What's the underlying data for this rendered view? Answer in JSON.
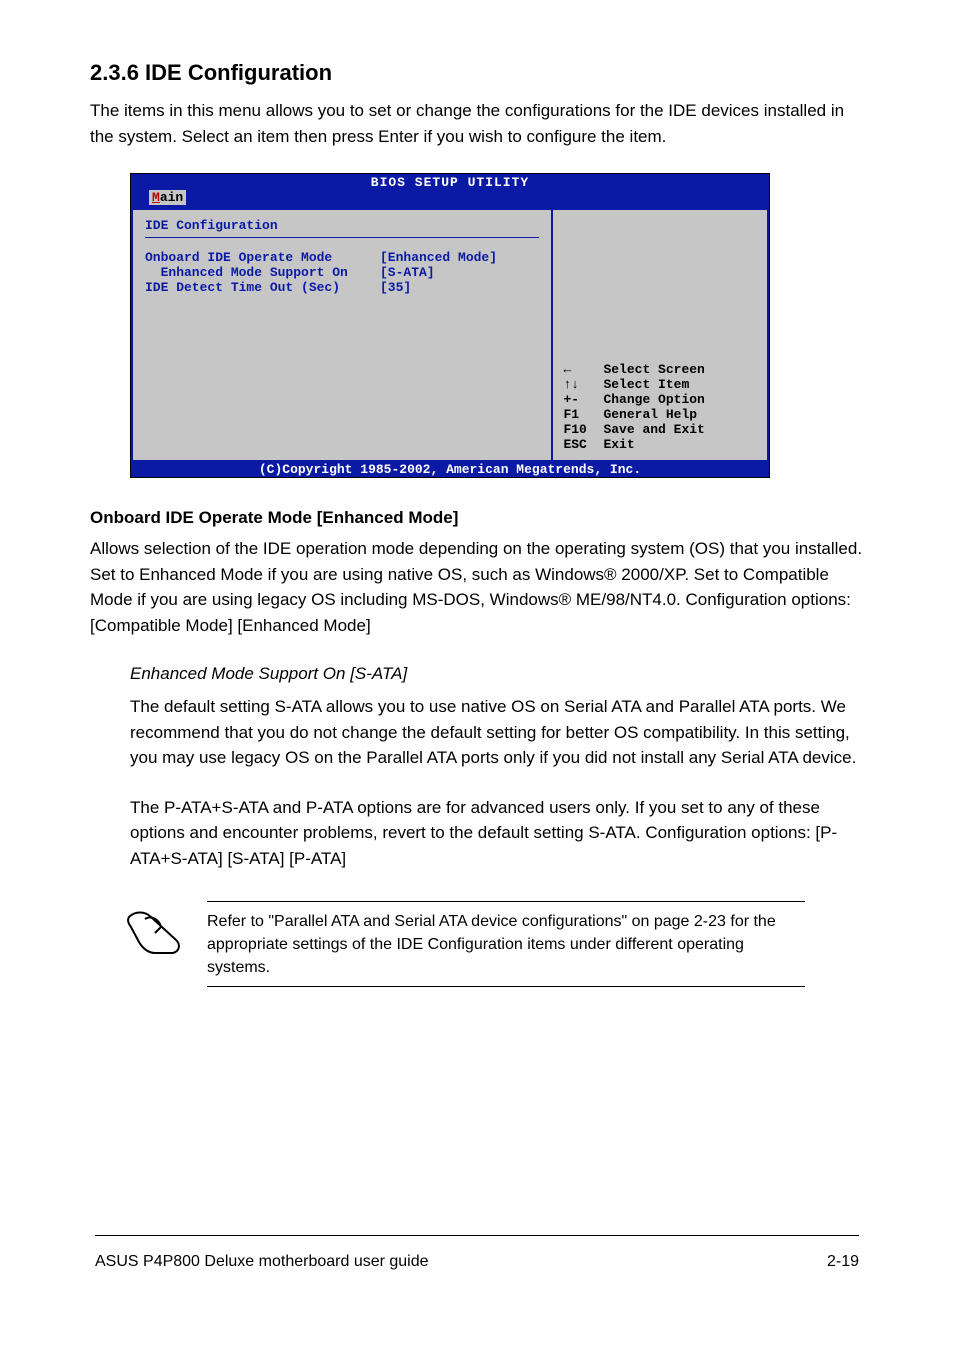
{
  "section": {
    "heading": "2.3.6 IDE Configuration",
    "body": "The items in this menu allows you to set or change the configurations for the IDE devices installed in the system. Select an item then press Enter if you wish to configure the item."
  },
  "bios": {
    "title": "BIOS SETUP UTILITY",
    "tab": {
      "accel": "M",
      "rest": "ain"
    },
    "panel_title": "IDE Configuration",
    "rows": [
      {
        "label": "Onboard IDE Operate Mode",
        "value": "[Enhanced Mode]"
      },
      {
        "label": "  Enhanced Mode Support On",
        "value": "[S-ATA]"
      },
      {
        "label": "IDE Detect Time Out (Sec)",
        "value": "[35]"
      }
    ],
    "help": [
      {
        "key": "←",
        "desc": "Select Screen"
      },
      {
        "key": "↑↓",
        "desc": "Select Item"
      },
      {
        "key": "+-",
        "desc": "Change Option"
      },
      {
        "key": "F1",
        "desc": "General Help"
      },
      {
        "key": "F10",
        "desc": "Save and Exit"
      },
      {
        "key": "ESC",
        "desc": "Exit"
      }
    ],
    "footer": "(C)Copyright 1985-2002, American Megatrends, Inc."
  },
  "onboard": {
    "title": "Onboard IDE Operate Mode [Enhanced Mode]",
    "body": "Allows selection of the IDE operation mode depending on the operating system (OS) that you installed. Set to Enhanced Mode if you are using native OS, such as Windows® 2000/XP. Set to Compatible Mode if you are using legacy OS including MS-DOS, Windows® ME/98/NT4.0. Configuration options: [Compatible Mode] [Enhanced Mode]"
  },
  "enhanced": {
    "heading": "Enhanced Mode Support On [S-ATA]",
    "body": "The default setting S-ATA allows you to use native OS on Serial ATA and Parallel ATA ports. We recommend that you do not change the default setting for better OS compatibility. In this setting, you may use legacy OS on the Parallel ATA ports only if you did not install any Serial ATA device.",
    "body2": "The P-ATA+S-ATA and P-ATA options are for advanced users only. If you set to any of these options and encounter problems, revert to the default setting S-ATA. Configuration options: [P-ATA+S-ATA] [S-ATA] [P-ATA]"
  },
  "note": {
    "text": "Refer to \"Parallel ATA and Serial ATA device configurations\" on page 2-23 for the appropriate settings of the IDE Configuration items under different operating systems."
  },
  "footer": {
    "left": "ASUS P4P800 Deluxe motherboard user guide",
    "right": "2-19"
  }
}
